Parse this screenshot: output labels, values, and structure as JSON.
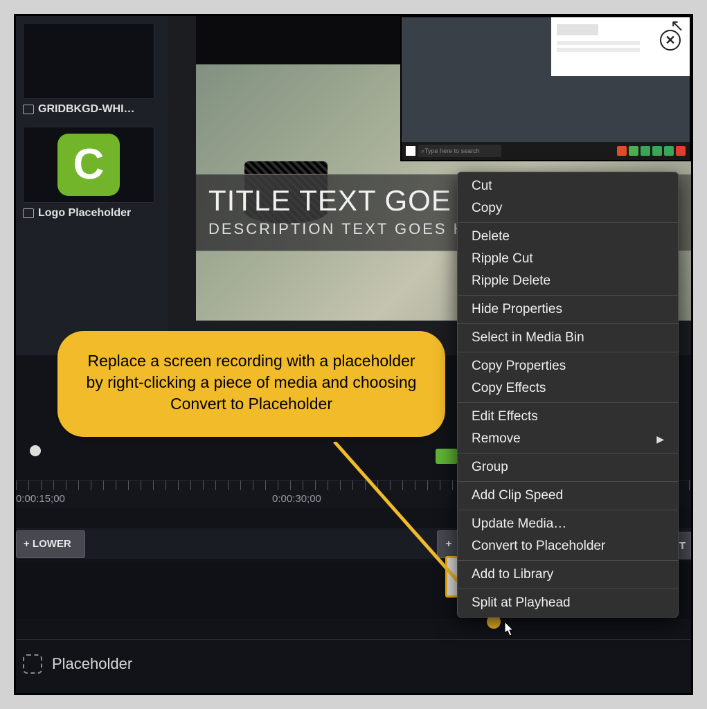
{
  "media_bin": {
    "items": [
      {
        "label": "GRIDBKGD-WHI…"
      },
      {
        "label": "Logo Placeholder"
      }
    ]
  },
  "preview": {
    "taskbar_search": "Type here to search",
    "title": "TITLE TEXT GOE",
    "description": "DESCRIPTION TEXT GOES HE"
  },
  "callout": {
    "text": "Replace a screen recording with a placeholder by right-clicking a piece of media and choosing Convert to Placeholder"
  },
  "timeline": {
    "ruler": [
      "0:00:15;00",
      "0:00:30;00"
    ],
    "clip_lower": "+  LOWER",
    "clip_plus": "+",
    "ut_label": "UT",
    "placeholder_label": "Placeholder"
  },
  "context_menu": {
    "items": [
      "Cut",
      "Copy",
      "---",
      "Delete",
      "Ripple Cut",
      "Ripple Delete",
      "---",
      "Hide Properties",
      "---",
      "Select in Media Bin",
      "---",
      "Copy Properties",
      "Copy Effects",
      "---",
      "Edit Effects",
      "Remove",
      "---",
      "Group",
      "---",
      "Add Clip Speed",
      "---",
      "Update Media…",
      "Convert to Placeholder",
      "---",
      "Add to Library",
      "---",
      "Split at Playhead"
    ],
    "submenu_on": "Remove"
  }
}
